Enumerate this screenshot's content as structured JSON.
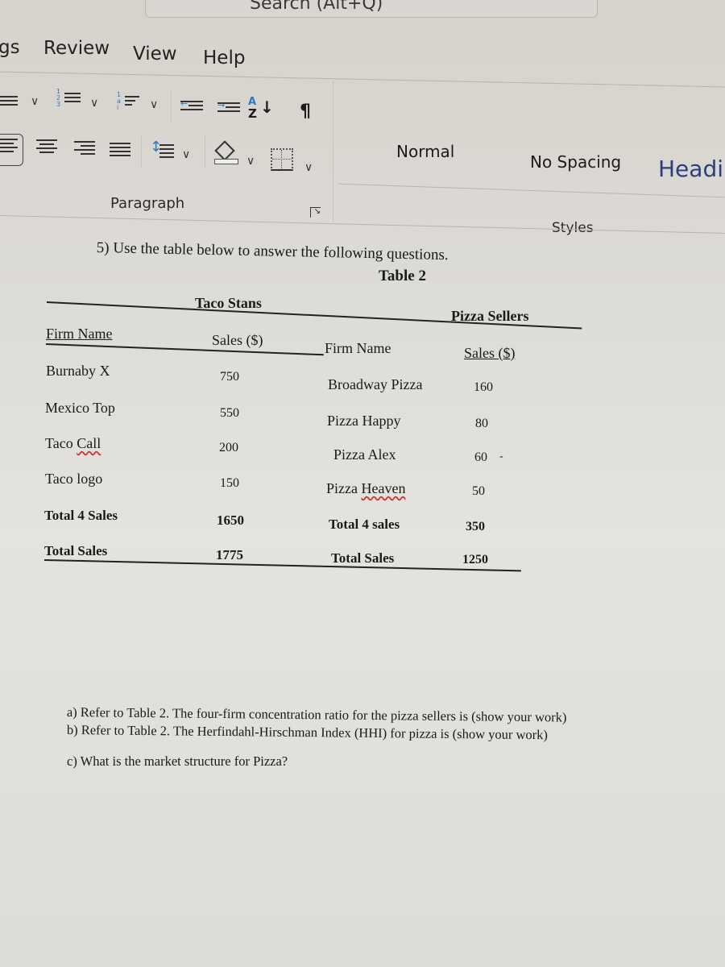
{
  "search": {
    "placeholder": "Search (Alt+Q)"
  },
  "menu": {
    "partial_left": "gs",
    "tabs": [
      "Review",
      "View",
      "Help"
    ]
  },
  "ribbon": {
    "paragraph_group": {
      "label": "Paragraph",
      "icons": [
        "bullets-icon",
        "numbering-icon",
        "multilevel-list-icon",
        "decrease-indent-icon",
        "increase-indent-icon",
        "sort-icon",
        "show-formatting-marks-icon",
        "align-left-icon",
        "align-center-icon",
        "align-right-icon",
        "justify-icon",
        "line-spacing-icon",
        "shading-icon",
        "borders-icon",
        "dialog-launcher-icon"
      ],
      "sort_glyph": "A↓Z",
      "pilcrow": "¶"
    },
    "styles_group": {
      "label": "Styles",
      "items": [
        "Normal",
        "No Spacing",
        "Headi"
      ]
    }
  },
  "document": {
    "question_intro": "5) Use the table below to answer the following questions.",
    "table_caption": "Table 2",
    "taco": {
      "group_title": "Taco Stans",
      "col_firm": "Firm Name",
      "col_sales": "Sales ($)",
      "rows": [
        {
          "firm": "Burnaby X",
          "sales": "750"
        },
        {
          "firm": "Mexico Top",
          "sales": "550"
        },
        {
          "firm": "Taco Call",
          "sales": "200"
        },
        {
          "firm": "Taco logo",
          "sales": "150"
        }
      ],
      "total4_label": "Total 4 Sales",
      "total4_value": "1650",
      "total_label": "Total Sales",
      "total_value": "1775"
    },
    "pizza": {
      "group_title": "Pizza Sellers",
      "col_firm": "Firm Name",
      "col_sales": "Sales ($)",
      "rows": [
        {
          "firm": "Broadway Pizza",
          "sales": "160"
        },
        {
          "firm": "Pizza Happy",
          "sales": "80"
        },
        {
          "firm": "Pizza Alex",
          "sales": "60"
        },
        {
          "firm": "Pizza Heaven",
          "sales": "50"
        }
      ],
      "total4_label": "Total 4 sales",
      "total4_value": "350",
      "total_label": "Total Sales",
      "total_value": "1250"
    },
    "questions": [
      "a)  Refer to Table 2. The four-firm concentration ratio for the pizza sellers is (show your work)",
      "b)  Refer to Table 2.  The Herfindahl-Hirschman Index (HHI) for pizza is (show your work)",
      "c)  What is the market structure for Pizza?"
    ]
  }
}
